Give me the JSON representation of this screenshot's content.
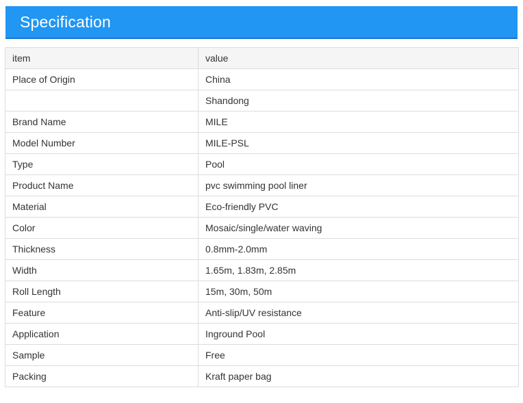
{
  "header": {
    "title": "Specification"
  },
  "table": {
    "columns": [
      "item",
      "value"
    ],
    "rows": [
      {
        "item": "Place of Origin",
        "value": "China"
      },
      {
        "item": "",
        "value": "Shandong"
      },
      {
        "item": "Brand Name",
        "value": "MILE"
      },
      {
        "item": "Model Number",
        "value": "MILE-PSL"
      },
      {
        "item": "Type",
        "value": "Pool"
      },
      {
        "item": "Product Name",
        "value": "pvc swimming pool liner"
      },
      {
        "item": "Material",
        "value": "Eco-friendly PVC"
      },
      {
        "item": "Color",
        "value": "Mosaic/single/water waving"
      },
      {
        "item": "Thickness",
        "value": "0.8mm-2.0mm"
      },
      {
        "item": "Width",
        "value": "1.65m, 1.83m, 2.85m"
      },
      {
        "item": "Roll Length",
        "value": "15m, 30m, 50m"
      },
      {
        "item": "Feature",
        "value": "Anti-slip/UV resistance"
      },
      {
        "item": "Application",
        "value": "Inground Pool"
      },
      {
        "item": "Sample",
        "value": "Free"
      },
      {
        "item": "Packing",
        "value": "Kraft paper bag"
      }
    ]
  },
  "colors": {
    "header_bg": "#2196f3",
    "header_text": "#ffffff",
    "table_border": "#dcdcdc",
    "head_row_bg": "#f5f5f5",
    "cell_text": "#333333"
  }
}
